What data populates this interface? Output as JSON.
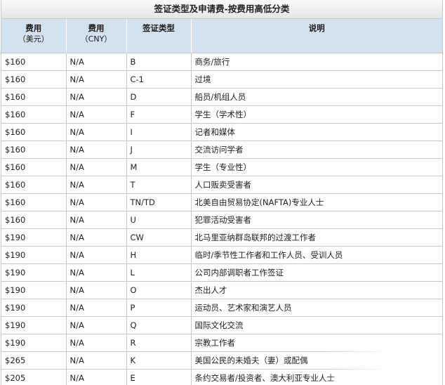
{
  "caption": "签证类型及申请费-按费用高低分类",
  "headers": {
    "usd_title": "费用",
    "usd_sub": "（美元）",
    "cny_title": "费用",
    "cny_sub": "（CNY）",
    "type": "签证类型",
    "desc": "说明"
  },
  "rows": [
    {
      "usd": "$160",
      "cny": "N/A",
      "type": "B",
      "desc": "商务/旅行"
    },
    {
      "usd": "$160",
      "cny": "N/A",
      "type": "C-1",
      "desc": "过境"
    },
    {
      "usd": "$160",
      "cny": "N/A",
      "type": "D",
      "desc": "船员/机组人员"
    },
    {
      "usd": "$160",
      "cny": "N/A",
      "type": "F",
      "desc": "学生（学术性）"
    },
    {
      "usd": "$160",
      "cny": "N/A",
      "type": "I",
      "desc": "记者和媒体"
    },
    {
      "usd": "$160",
      "cny": "N/A",
      "type": "J",
      "desc": "交流访问学者"
    },
    {
      "usd": "$160",
      "cny": "N/A",
      "type": "M",
      "desc": "学生（专业性）"
    },
    {
      "usd": "$160",
      "cny": "N/A",
      "type": "T",
      "desc": "人口贩卖受害者"
    },
    {
      "usd": "$160",
      "cny": "N/A",
      "type": "TN/TD",
      "desc": "北美自由贸易协定(NAFTA)专业人士"
    },
    {
      "usd": "$160",
      "cny": "N/A",
      "type": "U",
      "desc": "犯罪活动受害者"
    },
    {
      "usd": "$190",
      "cny": "N/A",
      "type": "CW",
      "desc": "北马里亚纳群岛联邦的过渡工作者"
    },
    {
      "usd": "$190",
      "cny": "N/A",
      "type": "H",
      "desc": "临时/季节性工作者和工作人员、受训人员"
    },
    {
      "usd": "$190",
      "cny": "N/A",
      "type": "L",
      "desc": "公司内部调职者工作签证"
    },
    {
      "usd": "$190",
      "cny": "N/A",
      "type": "O",
      "desc": "杰出人才"
    },
    {
      "usd": "$190",
      "cny": "N/A",
      "type": "P",
      "desc": "运动员、艺术家和演艺人员"
    },
    {
      "usd": "$190",
      "cny": "N/A",
      "type": "Q",
      "desc": "国际文化交流"
    },
    {
      "usd": "$190",
      "cny": "N/A",
      "type": "R",
      "desc": "宗教工作者"
    },
    {
      "usd": "$265",
      "cny": "N/A",
      "type": "K",
      "desc": "美国公民的未婚夫（妻）或配偶"
    },
    {
      "usd": "$205",
      "cny": "N/A",
      "type": "E",
      "desc": "条约交易者/投资者、澳大利亚专业人士"
    }
  ]
}
